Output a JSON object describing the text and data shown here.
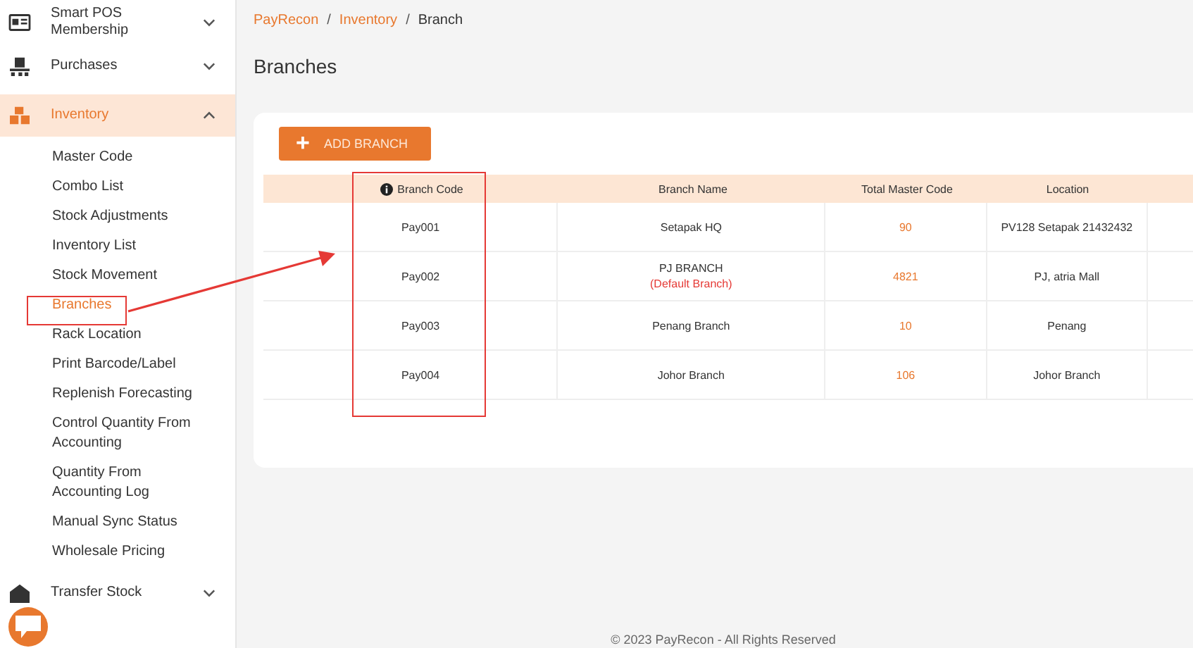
{
  "sidebar": {
    "items": [
      {
        "label": "Smart POS Membership",
        "kind": "card",
        "expanded": false,
        "selected": false
      },
      {
        "label": "Purchases",
        "kind": "pallet",
        "expanded": false,
        "selected": false
      },
      {
        "label": "Inventory",
        "kind": "boxes",
        "expanded": true,
        "selected": true,
        "children": [
          {
            "label": "Master Code",
            "selected": false
          },
          {
            "label": "Combo List",
            "selected": false
          },
          {
            "label": "Stock Adjustments",
            "selected": false
          },
          {
            "label": "Inventory List",
            "selected": false
          },
          {
            "label": "Stock Movement",
            "selected": false
          },
          {
            "label": "Branches",
            "selected": true
          },
          {
            "label": "Rack Location",
            "selected": false
          },
          {
            "label": "Print Barcode/Label",
            "selected": false
          },
          {
            "label": "Replenish Forecasting",
            "selected": false
          },
          {
            "label": "Control Quantity From Accounting",
            "selected": false
          },
          {
            "label": "Quantity From Accounting Log",
            "selected": false
          },
          {
            "label": "Manual Sync Status",
            "selected": false
          },
          {
            "label": "Wholesale Pricing",
            "selected": false
          }
        ]
      },
      {
        "label": "Transfer Stock",
        "kind": "warehouse",
        "expanded": false,
        "selected": false
      }
    ]
  },
  "breadcrumb": [
    {
      "label": "PayRecon",
      "link": true
    },
    {
      "label": "Inventory",
      "link": true
    },
    {
      "label": "Branch",
      "link": false
    }
  ],
  "separator": "/",
  "page_title": "Branches",
  "add_button": {
    "icon": "+",
    "label": "ADD BRANCH"
  },
  "table": {
    "columns": [
      "Branch Code",
      "Branch Name",
      "Total Master Code",
      "Location"
    ],
    "rows": [
      {
        "code": "Pay001",
        "name": "Setapak HQ",
        "total": "90",
        "location": "PV128 Setapak 21432432"
      },
      {
        "code": "Pay002",
        "name": "PJ BRANCH",
        "note": "(Default Branch)",
        "total": "4821",
        "location": "PJ, atria Mall"
      },
      {
        "code": "Pay003",
        "name": "Penang Branch",
        "total": "10",
        "location": "Penang"
      },
      {
        "code": "Pay004",
        "name": "Johor Branch",
        "total": "106",
        "location": "Johor Branch"
      }
    ]
  },
  "footer": "© 2023 PayRecon - All Rights Reserved"
}
